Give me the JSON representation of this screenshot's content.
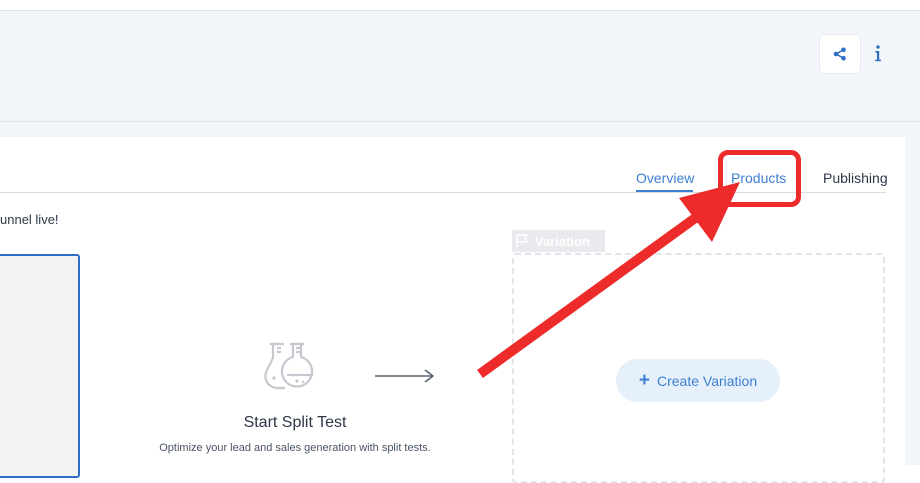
{
  "header": {
    "share_icon": "share-icon",
    "info_label": "i"
  },
  "tabs": [
    {
      "label": "Overview",
      "active": true
    },
    {
      "label": "Products",
      "highlighted": true
    },
    {
      "label": "Publishing"
    }
  ],
  "funnel_message": "unnel live!",
  "variation": {
    "tag_label": "Variation",
    "tag_icon": "flag-icon",
    "create_button_label": "Create Variation"
  },
  "split_test": {
    "icon": "flask-icon",
    "title": "Start Split Test",
    "subtitle": "Optimize your lead and sales generation with split tests."
  },
  "colors": {
    "accent": "#3d7fd0",
    "annotation": "#ee2b2b",
    "header_bg": "#f2f5f9"
  }
}
